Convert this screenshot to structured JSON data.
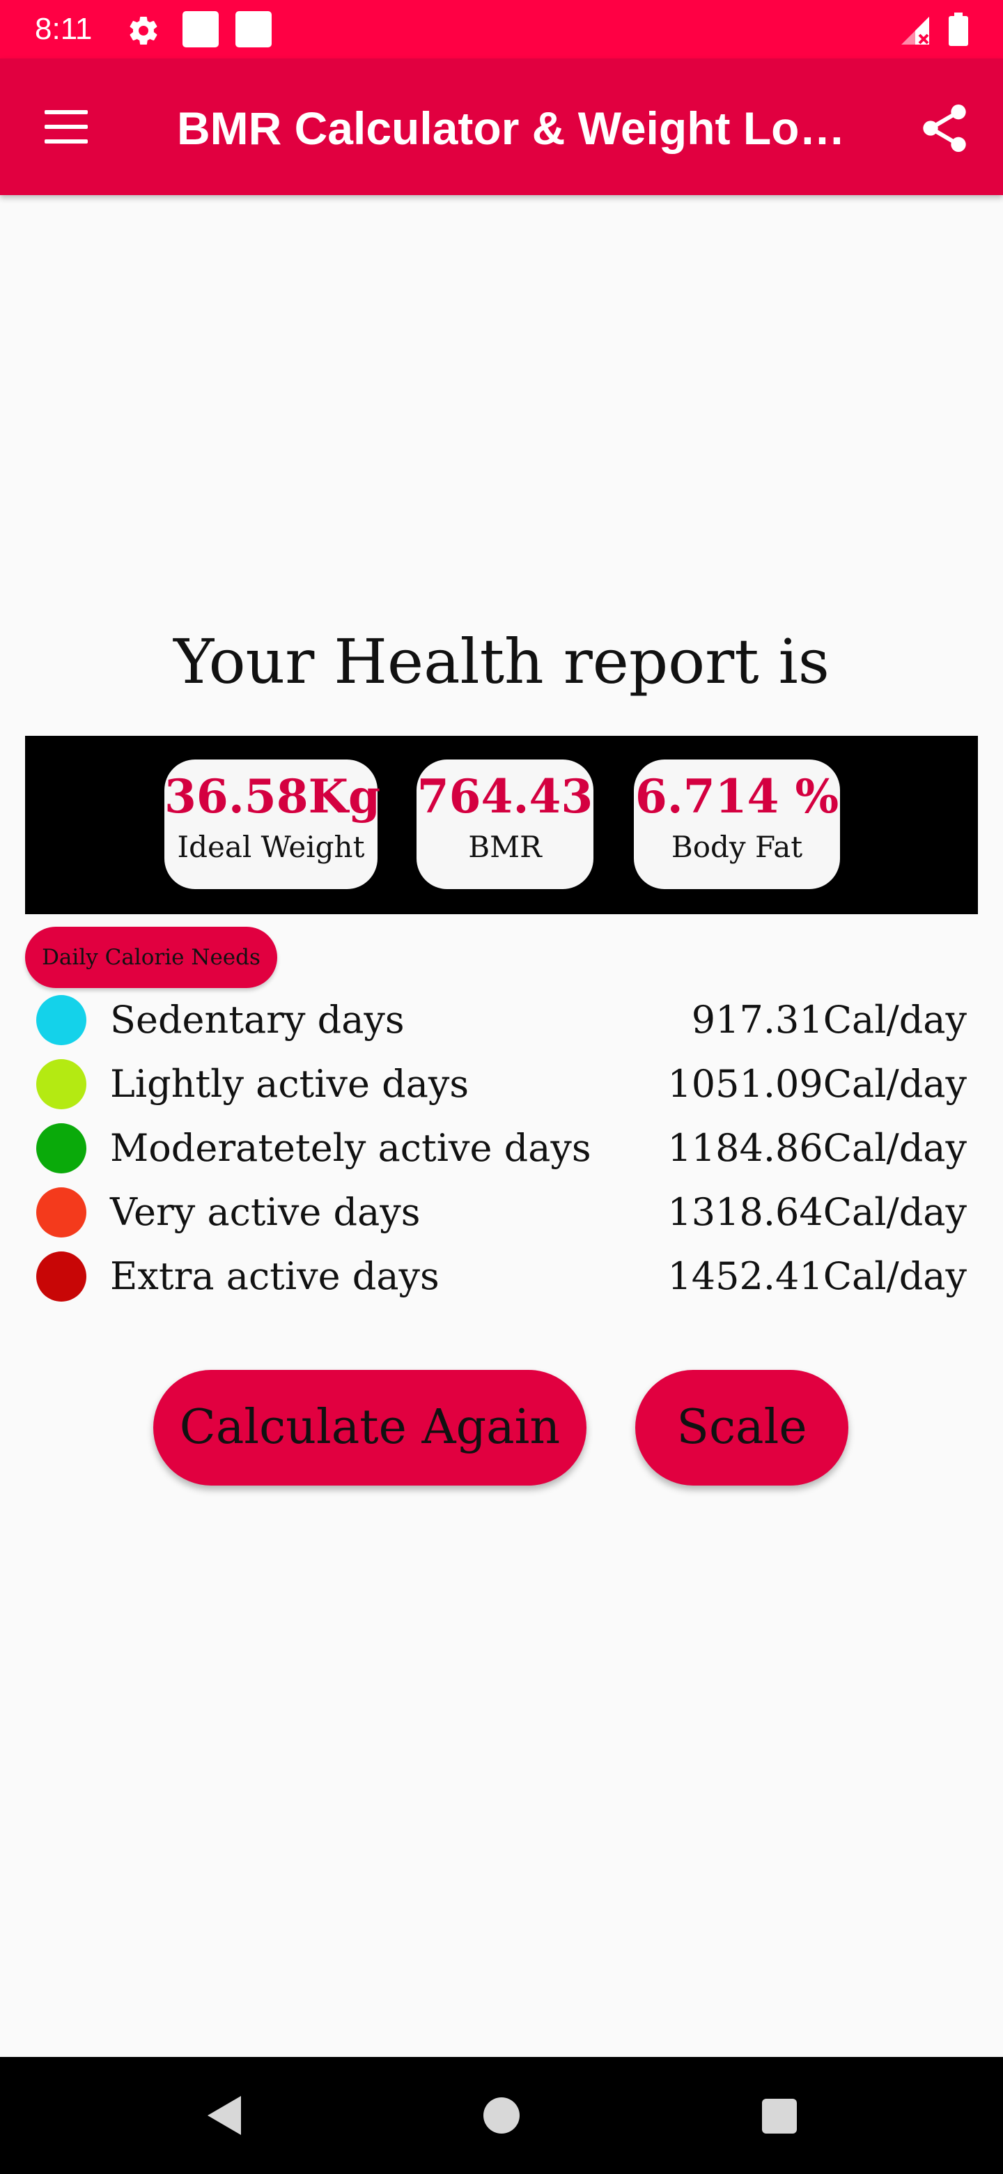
{
  "status_bar": {
    "time": "8:11",
    "icons": [
      "gear-icon",
      "notification-square-icon",
      "notification-square-icon",
      "signal-icon",
      "battery-icon"
    ]
  },
  "app_bar": {
    "title": "BMR Calculator & Weight Loss Calculator",
    "menu_icon": "hamburger-menu-icon",
    "share_icon": "share-icon",
    "color": "#e10040"
  },
  "report": {
    "title": "Your Health report is",
    "stats": [
      {
        "value": "36.58Kg",
        "label": "Ideal Weight"
      },
      {
        "value": "764.43",
        "label": "BMR"
      },
      {
        "value": "6.714 %",
        "label": "Body Fat"
      }
    ]
  },
  "calories": {
    "badge": "Daily Calorie Needs",
    "rows": [
      {
        "label": "Sedentary days",
        "value": "917.31Cal/day",
        "color": "#14d2ea"
      },
      {
        "label": "Lightly active days",
        "value": "1051.09Cal/day",
        "color": "#b4ea12"
      },
      {
        "label": "Moderatetely active days",
        "value": "1184.86Cal/day",
        "color": "#0aaa0a"
      },
      {
        "label": "Very active days",
        "value": "1318.64Cal/day",
        "color": "#f43a1c"
      },
      {
        "label": "Extra active days",
        "value": "1452.41Cal/day",
        "color": "#c80606"
      }
    ]
  },
  "buttons": {
    "calculate_again": "Calculate Again",
    "scale": "Scale"
  },
  "nav_bar": {
    "icons": [
      "back-icon",
      "home-icon",
      "recents-icon"
    ]
  },
  "colors": {
    "status_bar": "#ff0044",
    "accent": "#e10040",
    "value_text": "#d40040"
  }
}
